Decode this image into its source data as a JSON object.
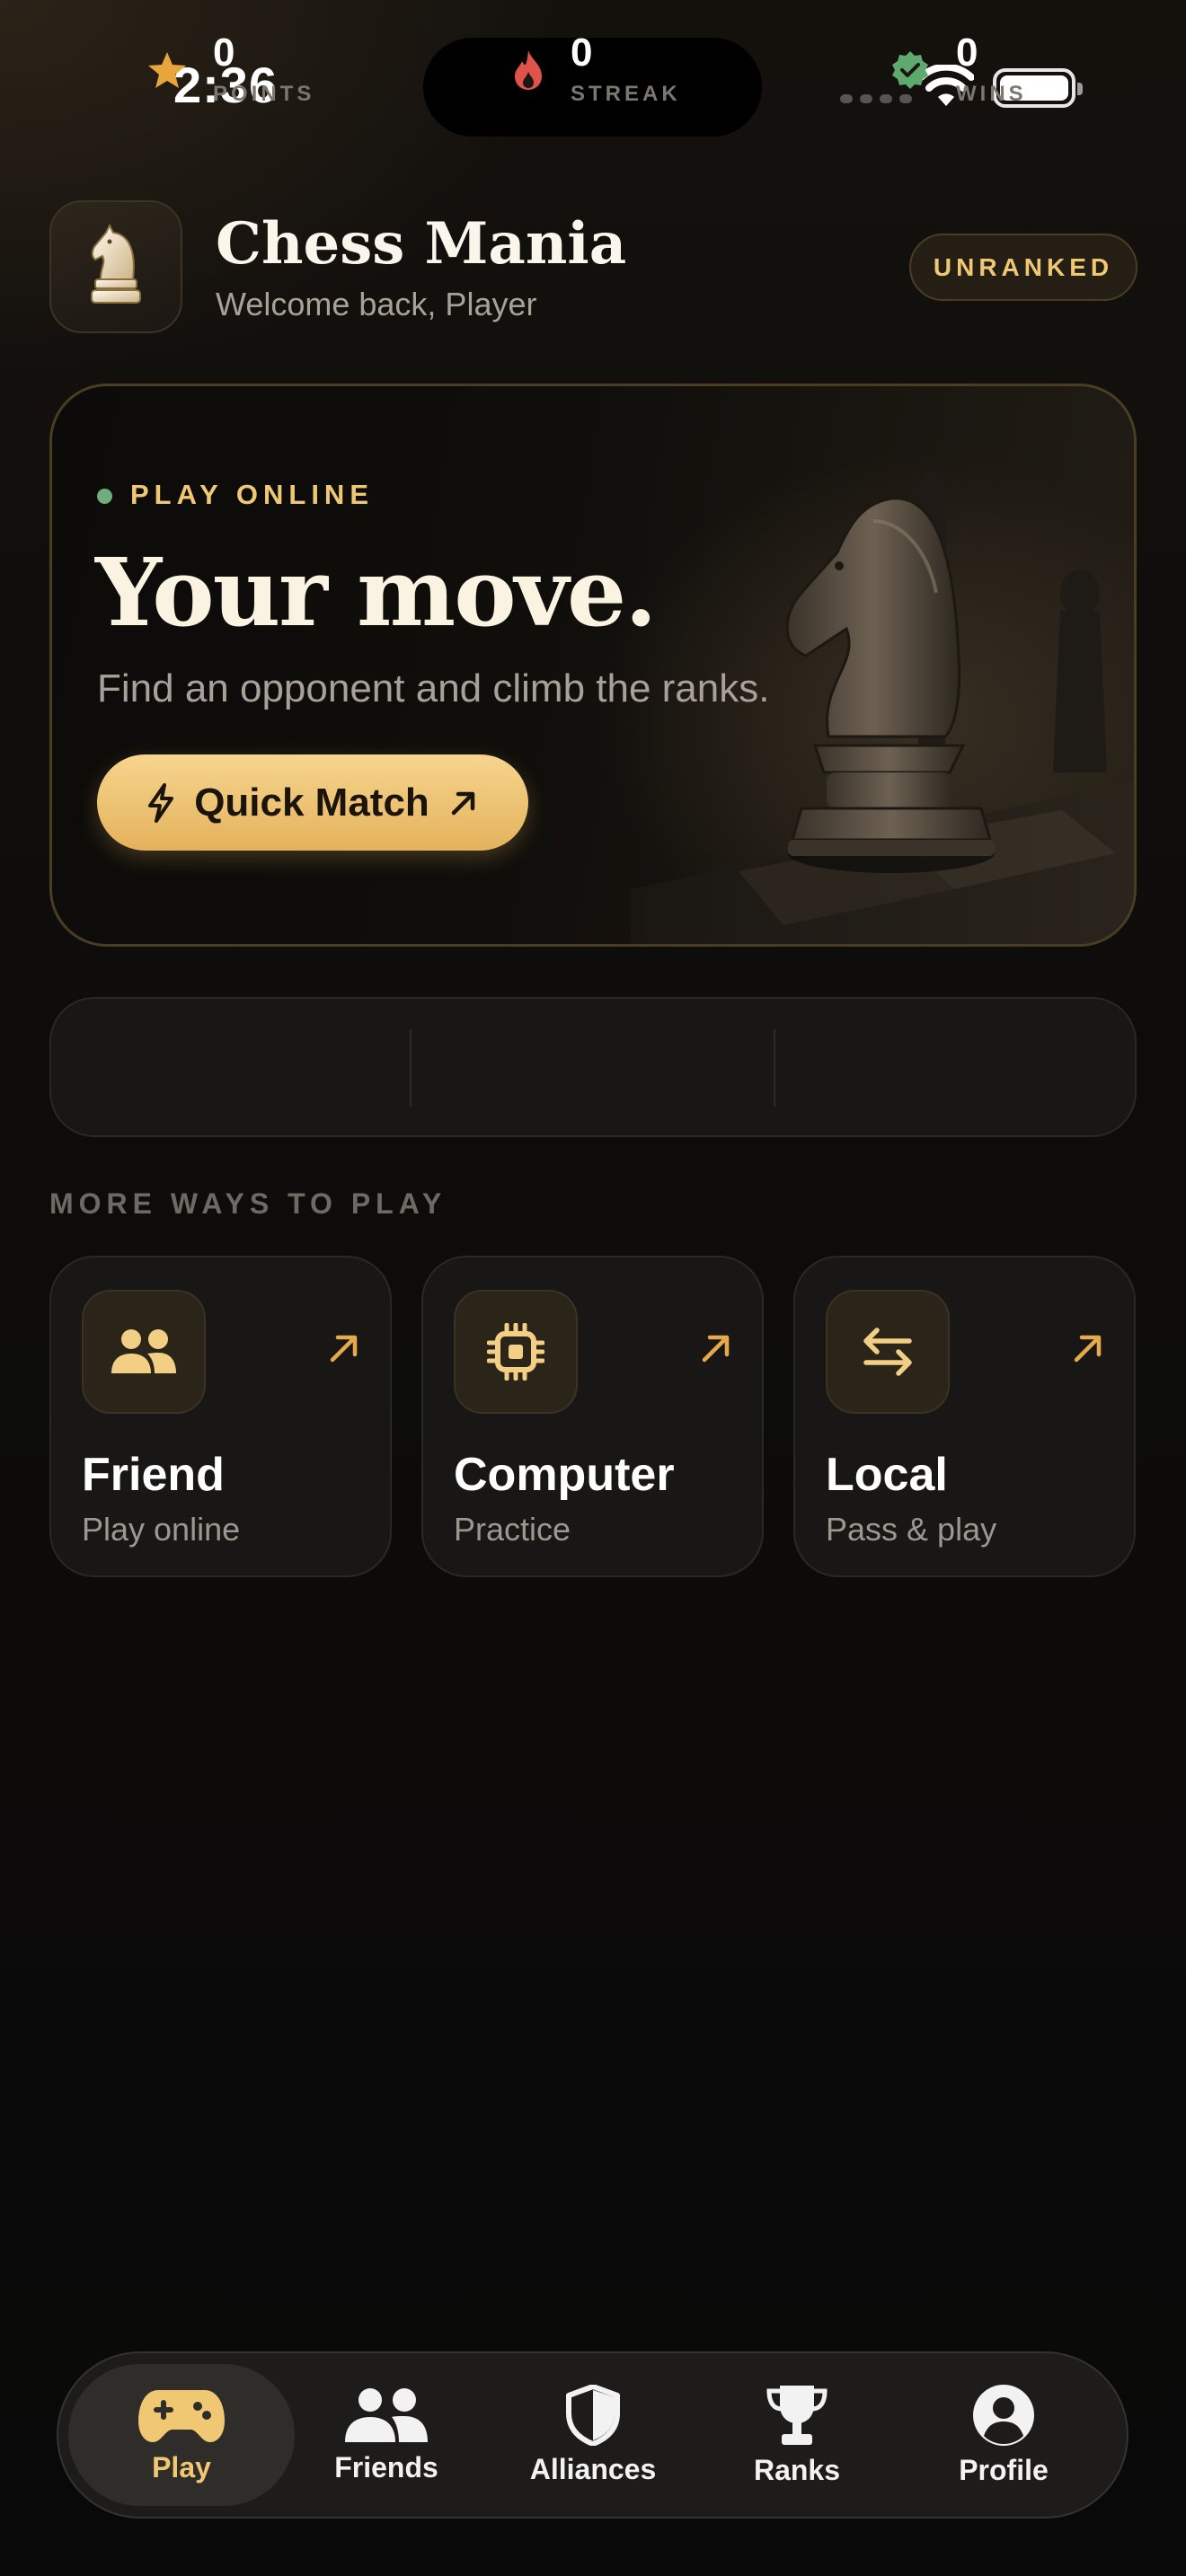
{
  "status_bar": {
    "time": "2:36"
  },
  "header": {
    "app_title": "Chess Mania",
    "welcome": "Welcome back, Player",
    "rank_badge": "UNRANKED",
    "logo_icon": "white-knight-icon"
  },
  "hero": {
    "eyebrow": "PLAY ONLINE",
    "title": "Your move.",
    "subtitle": "Find an opponent and climb the ranks.",
    "button_label": "Quick Match",
    "button_icon": "lightning-icon",
    "button_arrow_icon": "arrow-up-right-icon",
    "live_color": "#6fae7c"
  },
  "stats": [
    {
      "value": "0",
      "label": "POINTS",
      "icon": "star-icon",
      "color": "#e8a53c"
    },
    {
      "value": "0",
      "label": "STREAK",
      "icon": "flame-icon",
      "color": "#e0534a"
    },
    {
      "value": "0",
      "label": "WINS",
      "icon": "verified-badge-icon",
      "color": "#5fa86e"
    }
  ],
  "more_ways": {
    "section_label": "MORE WAYS TO PLAY",
    "modes": [
      {
        "title": "Friend",
        "subtitle": "Play online",
        "icon": "people-icon"
      },
      {
        "title": "Computer",
        "subtitle": "Practice",
        "icon": "cpu-chip-icon"
      },
      {
        "title": "Local",
        "subtitle": "Pass & play",
        "icon": "swap-arrows-icon"
      }
    ]
  },
  "tab_bar": {
    "active": "Play",
    "tabs": [
      {
        "label": "Play",
        "icon": "gamepad-icon"
      },
      {
        "label": "Friends",
        "icon": "people-icon"
      },
      {
        "label": "Alliances",
        "icon": "shield-icon"
      },
      {
        "label": "Ranks",
        "icon": "trophy-icon"
      },
      {
        "label": "Profile",
        "icon": "user-circle-icon"
      }
    ]
  },
  "colors": {
    "accent": "#f0c873",
    "accent_button": "#e4b25c",
    "background": "#0d0c0b"
  }
}
